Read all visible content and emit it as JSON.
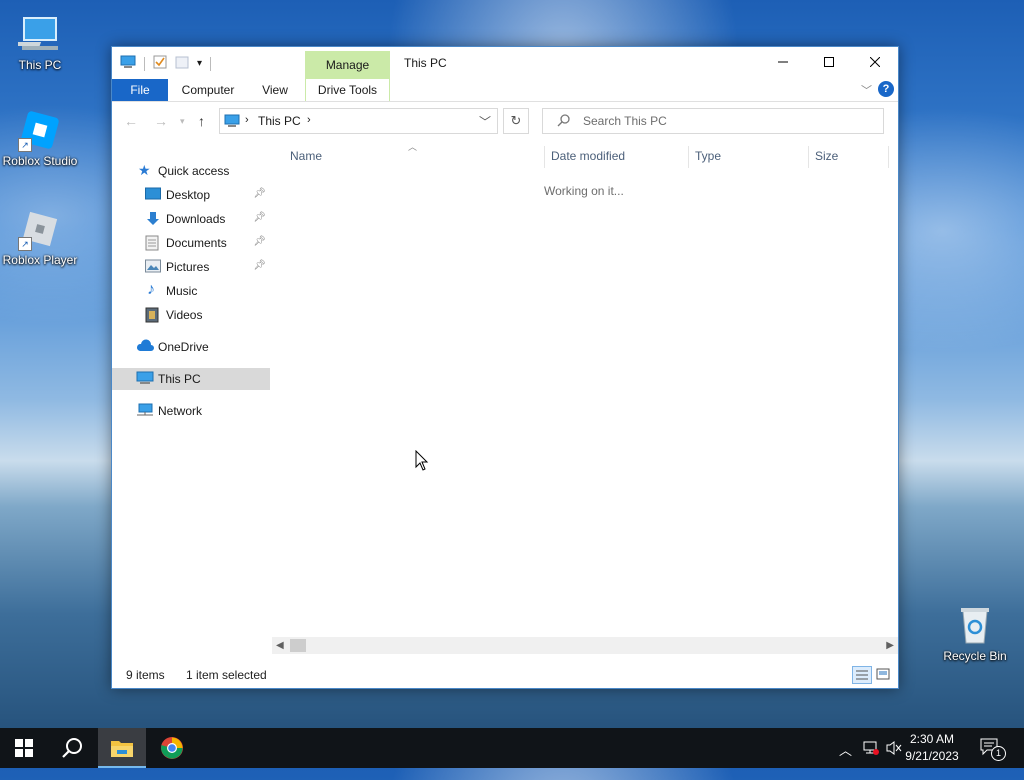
{
  "desktop": {
    "icons": [
      {
        "label": "This PC"
      },
      {
        "label": "Roblox Studio"
      },
      {
        "label": "Roblox Player"
      },
      {
        "label": "Recycle Bin"
      }
    ]
  },
  "window": {
    "title": "This PC",
    "context_tab": "Manage",
    "ribbon_tabs": [
      "File",
      "Computer",
      "View",
      "Drive Tools"
    ],
    "address": {
      "segment": "This PC"
    },
    "search": {
      "placeholder": "Search This PC"
    },
    "nav": {
      "quick_access": "Quick access",
      "pinned": [
        "Desktop",
        "Downloads",
        "Documents",
        "Pictures"
      ],
      "unpinned": [
        "Music",
        "Videos"
      ],
      "onedrive": "OneDrive",
      "this_pc": "This PC",
      "network": "Network"
    },
    "columns": [
      "Name",
      "Date modified",
      "Type",
      "Size"
    ],
    "loading_text": "Working on it...",
    "status": {
      "items": "9 items",
      "selected": "1 item selected"
    }
  },
  "taskbar": {
    "time": "2:30 AM",
    "date": "9/21/2023",
    "notification_count": "1"
  },
  "colors": {
    "accent": "#1967c8",
    "manage_tab": "#cbeaa8",
    "selected_nav": "#d9d9d9",
    "taskbar": "#101418"
  }
}
